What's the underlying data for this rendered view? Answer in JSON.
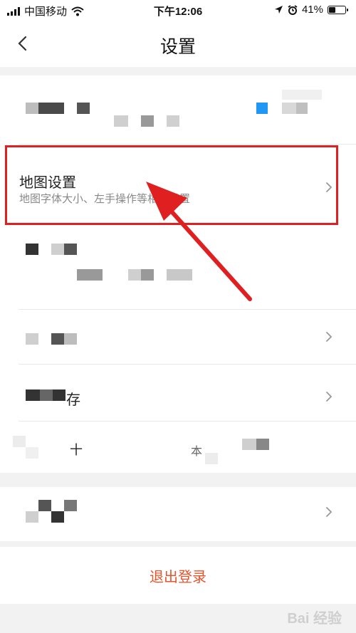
{
  "status_bar": {
    "carrier": "中国移动",
    "time": "下午12:06",
    "battery": "41%",
    "battery_level": 0.41
  },
  "nav": {
    "title": "设置"
  },
  "rows": {
    "map_settings": {
      "title": "地图设置",
      "subtitle": "地图字体大小、左手操作等相关设置"
    },
    "row_storage": {
      "partial_title": "存"
    },
    "row_other": {
      "char_a": "十",
      "char_b": "本"
    }
  },
  "logout_label": "退出登录",
  "watermark": "Bai 经验",
  "colors": {
    "accent": "#e8532b",
    "highlight": "#e02020"
  },
  "icons": {
    "back": "chevron-left-icon",
    "row_arrow": "chevron-right-icon",
    "signal": "signal-icon",
    "wifi": "wifi-icon",
    "location": "location-arrow-icon",
    "alarm": "alarm-icon",
    "battery": "battery-icon"
  }
}
